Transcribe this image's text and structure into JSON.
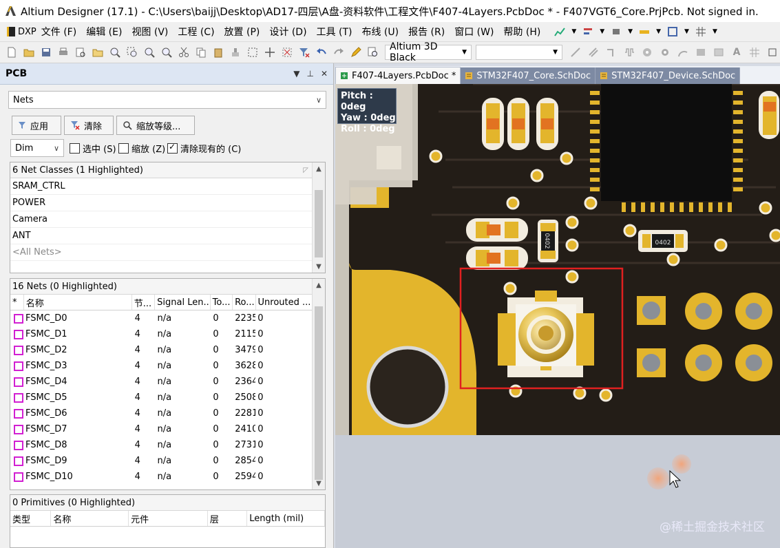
{
  "window": {
    "title": "Altium Designer (17.1) - C:\\Users\\baijj\\Desktop\\AD17-四层\\A盘-资料软件\\工程文件\\F407-4Layers.PcbDoc * - F407VGT6_Core.PrjPcb. Not signed in."
  },
  "menu": {
    "items": [
      "DXP",
      "文件 (F)",
      "编辑 (E)",
      "视图 (V)",
      "工程 (C)",
      "放置 (P)",
      "设计 (D)",
      "工具 (T)",
      "布线 (U)",
      "报告 (R)",
      "窗口 (W)",
      "帮助 (H)"
    ]
  },
  "toolbar": {
    "view_preset": "Altium 3D Black",
    "second_combo": ""
  },
  "panel": {
    "title": "PCB",
    "mode": "Nets",
    "apply_label": "应用",
    "clear_label": "清除",
    "zoom_label": "缩放等级...",
    "mask_mode": "Dim",
    "opt_select": "选中 (S)",
    "opt_zoom": "缩放 (Z)",
    "opt_clear": "清除现有的 (C)",
    "opt_select_checked": false,
    "opt_zoom_checked": false,
    "opt_clear_checked": true,
    "classes_header": "6 Net Classes (1 Highlighted)",
    "classes": [
      "SRAM_CTRL",
      "POWER",
      "Camera",
      "ANT",
      "<All Nets>"
    ],
    "nets_header": "16 Nets (0 Highlighted)",
    "net_columns": [
      "*",
      "名称",
      "节...",
      "Signal Len...",
      "To...",
      "Ro...",
      "Unrouted ..."
    ],
    "nets": [
      {
        "name": "FSMC_D0",
        "nodes": "4",
        "signal": "n/a",
        "total": "0",
        "routed": "2235",
        "unrouted": "0"
      },
      {
        "name": "FSMC_D1",
        "nodes": "4",
        "signal": "n/a",
        "total": "0",
        "routed": "2115",
        "unrouted": "0"
      },
      {
        "name": "FSMC_D2",
        "nodes": "4",
        "signal": "n/a",
        "total": "0",
        "routed": "3479",
        "unrouted": "0"
      },
      {
        "name": "FSMC_D3",
        "nodes": "4",
        "signal": "n/a",
        "total": "0",
        "routed": "3628",
        "unrouted": "0"
      },
      {
        "name": "FSMC_D4",
        "nodes": "4",
        "signal": "n/a",
        "total": "0",
        "routed": "2364",
        "unrouted": "0"
      },
      {
        "name": "FSMC_D5",
        "nodes": "4",
        "signal": "n/a",
        "total": "0",
        "routed": "2508",
        "unrouted": "0"
      },
      {
        "name": "FSMC_D6",
        "nodes": "4",
        "signal": "n/a",
        "total": "0",
        "routed": "2281",
        "unrouted": "0"
      },
      {
        "name": "FSMC_D7",
        "nodes": "4",
        "signal": "n/a",
        "total": "0",
        "routed": "2410",
        "unrouted": "0"
      },
      {
        "name": "FSMC_D8",
        "nodes": "4",
        "signal": "n/a",
        "total": "0",
        "routed": "2731",
        "unrouted": "0"
      },
      {
        "name": "FSMC_D9",
        "nodes": "4",
        "signal": "n/a",
        "total": "0",
        "routed": "2854",
        "unrouted": "0"
      },
      {
        "name": "FSMC_D10",
        "nodes": "4",
        "signal": "n/a",
        "total": "0",
        "routed": "2594",
        "unrouted": "0"
      }
    ],
    "primitives_header": "0 Primitives (0 Highlighted)",
    "primitive_columns": [
      "类型",
      "名称",
      "元件",
      "层",
      "Length (mil)"
    ]
  },
  "tabs": [
    {
      "label": "F407-4Layers.PcbDoc *",
      "active": true
    },
    {
      "label": "STM32F407_Core.SchDoc",
      "active": false
    },
    {
      "label": "STM32F407_Device.SchDoc",
      "active": false
    }
  ],
  "view3d": {
    "pitch": "Pitch : 0deg",
    "yaw": "Yaw : 0deg",
    "roll": "Roll : 0deg",
    "chip_label_1": "0402",
    "chip_label_2": "0402"
  },
  "watermark": "@稀土掘金技术社区",
  "colors": {
    "board": "#231d17",
    "copper": "#e3b52c",
    "highlight": "#e02020",
    "net_swatch": "#d21fd2"
  }
}
